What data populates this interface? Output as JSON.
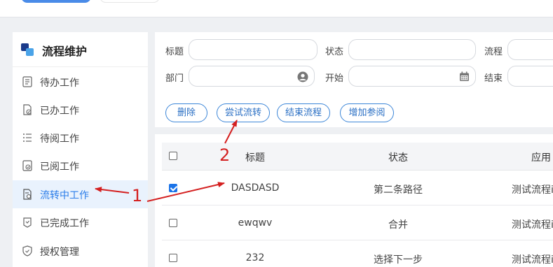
{
  "sidebar": {
    "title": "流程维护",
    "items": [
      {
        "label": "待办工作",
        "icon": "todo-list-icon",
        "active": false
      },
      {
        "label": "已办工作",
        "icon": "done-doc-icon",
        "active": false
      },
      {
        "label": "待阅工作",
        "icon": "to-read-list-icon",
        "active": false
      },
      {
        "label": "已阅工作",
        "icon": "read-doc-icon",
        "active": false
      },
      {
        "label": "流转中工作",
        "icon": "in-flow-doc-icon",
        "active": true
      },
      {
        "label": "已完成工作",
        "icon": "completed-icon",
        "active": false
      },
      {
        "label": "授权管理",
        "icon": "shield-icon",
        "active": false
      }
    ]
  },
  "filters": {
    "title_label": "标题",
    "status_label": "状态",
    "process_label": "流程",
    "dept_label": "部门",
    "start_label": "开始",
    "end_label": "结束"
  },
  "actions": {
    "delete": "删除",
    "try_transfer": "尝试流转",
    "end_process": "结束流程",
    "add_reviewer": "增加参阅"
  },
  "table": {
    "columns": [
      "标题",
      "状态",
      "应用"
    ],
    "rows": [
      {
        "checked": true,
        "title": "DASDASD",
        "status": "第二条路径",
        "app": "测试流程i"
      },
      {
        "checked": false,
        "title": "ewqwv",
        "status": "合并",
        "app": "测试流程i"
      },
      {
        "checked": false,
        "title": "232",
        "status": "选择下一步",
        "app": "测试流程i"
      }
    ]
  },
  "annotations": {
    "label_1": "1",
    "label_2": "2",
    "color": "#d42020"
  },
  "colors": {
    "accent": "#2b7de9",
    "active_bg": "#e9f2fd",
    "page_bg": "#eef0f3"
  }
}
